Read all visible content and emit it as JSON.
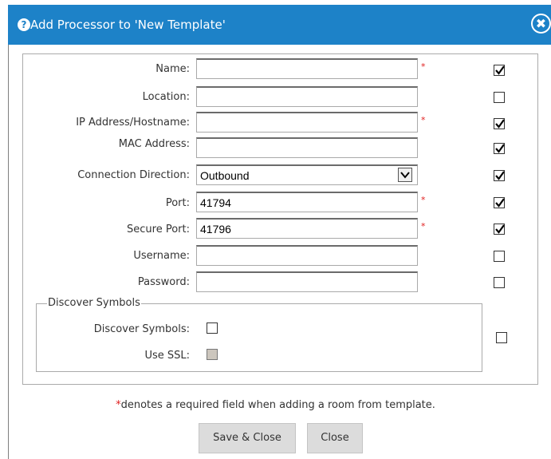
{
  "dialog": {
    "title": "Add Processor to 'New Template'",
    "help_icon": "question-circle-icon",
    "help_glyph": "?",
    "close_icon": "close-circle-icon",
    "close_glyph": "✖",
    "accent_color": "#1d82c8"
  },
  "form": {
    "name": {
      "label": "Name:",
      "value": "",
      "required": "*",
      "checked": true
    },
    "location": {
      "label": "Location:",
      "value": "",
      "checked": false
    },
    "ip": {
      "label": "IP Address/Hostname:",
      "value": "",
      "required": "*",
      "checked": true
    },
    "mac": {
      "label": "MAC Address:",
      "value": "",
      "checked": true
    },
    "direction": {
      "label": "Connection Direction:",
      "value": "Outbound",
      "checked": true
    },
    "port": {
      "label": "Port:",
      "value": "41794",
      "required": "*",
      "checked": true
    },
    "secure_port": {
      "label": "Secure Port:",
      "value": "41796",
      "required": "*",
      "checked": true
    },
    "username": {
      "label": "Username:",
      "value": "",
      "checked": false
    },
    "password": {
      "label": "Password:",
      "value": "",
      "checked": false
    }
  },
  "discover": {
    "legend": "Discover Symbols",
    "discover_label": "Discover Symbols:",
    "discover_checked": false,
    "ssl_label": "Use SSL:",
    "ssl_checked": false,
    "group_checked": false
  },
  "footer": {
    "note_star": "*",
    "note_text": "denotes a required field when adding a room from template.",
    "save_label": "Save & Close",
    "close_label": "Close"
  }
}
